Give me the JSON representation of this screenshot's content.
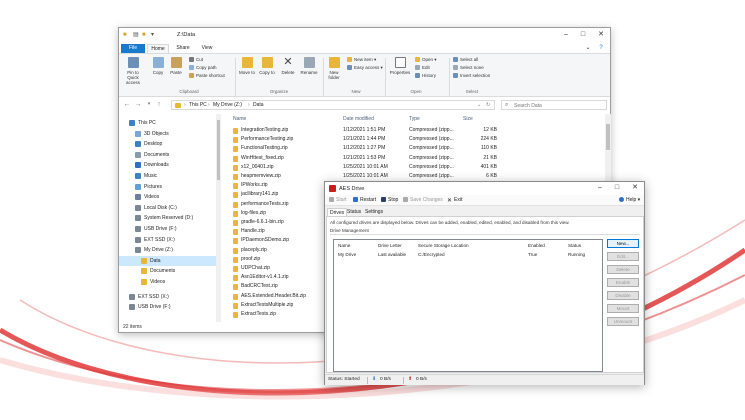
{
  "colors": {
    "accent_blue": "#1979ca",
    "folder_yellow": "#e8b63a",
    "selection": "#cce8ff",
    "brand_red": "#c81e1e",
    "swoosh_red": "#e03a3a"
  },
  "explorer": {
    "title": "Z:\\Data",
    "menu_tabs": [
      "File",
      "Home",
      "Share",
      "View"
    ],
    "ribbon": {
      "pin_label": "Pin to Quick access",
      "copy_label": "Copy",
      "paste_label": "Paste",
      "cut_label": "Cut",
      "copy_path_label": "Copy path",
      "paste_shortcut_label": "Paste shortcut",
      "move_to_label": "Move to",
      "copy_to_label": "Copy to",
      "delete_label": "Delete",
      "rename_label": "Rename",
      "new_folder_label": "New folder",
      "new_item_label": "New item",
      "easy_access_label": "Easy access",
      "properties_label": "Properties",
      "open_label": "Open",
      "edit_label": "Edit",
      "history_label": "History",
      "select_all_label": "Select all",
      "select_none_label": "Select none",
      "invert_selection_label": "Invert selection",
      "groups": [
        "Clipboard",
        "Organize",
        "New",
        "Open",
        "Select"
      ]
    },
    "breadcrumb": [
      "This PC",
      "My Drive (Z:)",
      "Data"
    ],
    "search_placeholder": "Search Data",
    "nav_items": [
      {
        "label": "This PC",
        "icon": "computer-icon"
      },
      {
        "label": "3D Objects",
        "icon": "cube-icon"
      },
      {
        "label": "Desktop",
        "icon": "desktop-icon"
      },
      {
        "label": "Documents",
        "icon": "documents-icon"
      },
      {
        "label": "Downloads",
        "icon": "download-icon"
      },
      {
        "label": "Music",
        "icon": "music-icon"
      },
      {
        "label": "Pictures",
        "icon": "pictures-icon"
      },
      {
        "label": "Videos",
        "icon": "videos-icon"
      },
      {
        "label": "Local Disk (C:)",
        "icon": "drive-icon"
      },
      {
        "label": "System Reserved (D:)",
        "icon": "drive-icon"
      },
      {
        "label": "USB Drive (F:)",
        "icon": "usb-drive-icon"
      },
      {
        "label": "EXT SSD (X:)",
        "icon": "drive-icon"
      },
      {
        "label": "My Drive (Z:)",
        "icon": "drive-icon"
      },
      {
        "label": "Data",
        "icon": "folder-icon"
      },
      {
        "label": "Documents",
        "icon": "folder-icon"
      },
      {
        "label": "Videos",
        "icon": "folder-icon"
      },
      {
        "label": "EXT SSD (X:)",
        "icon": "drive-icon"
      },
      {
        "label": "USB Drive (F:)",
        "icon": "usb-drive-icon"
      }
    ],
    "columns": [
      "Name",
      "Date modified",
      "Type",
      "Size"
    ],
    "files": [
      {
        "name": "IntegrationTesting.zip",
        "date": "1/12/2021 1:51 PM",
        "type": "Compressed (zipp...",
        "size": "12 KB"
      },
      {
        "name": "PerformanceTesting.zip",
        "date": "1/21/2021 1:44 PM",
        "type": "Compressed (zipp...",
        "size": "224 KB"
      },
      {
        "name": "FunctionalTesting.zip",
        "date": "1/12/2021 1:27 PM",
        "type": "Compressed (zipp...",
        "size": "110 KB"
      },
      {
        "name": "WinHttest_fixed.zip",
        "date": "1/21/2021 1:53 PM",
        "type": "Compressed (zipp...",
        "size": "21 KB"
      },
      {
        "name": "x12_00401.zip",
        "date": "1/25/2021 10:01 AM",
        "type": "Compressed (zipp...",
        "size": "401 KB"
      },
      {
        "name": "heapmemview.zip",
        "date": "1/25/2021 10:01 AM",
        "type": "Compressed (zipp...",
        "size": "6 KB"
      },
      {
        "name": "IPWorks.zip",
        "date": "",
        "type": "",
        "size": ""
      },
      {
        "name": "jacllibrary141.zip",
        "date": "",
        "type": "",
        "size": ""
      },
      {
        "name": "performanceTests.zip",
        "date": "",
        "type": "",
        "size": ""
      },
      {
        "name": "log-files.zip",
        "date": "",
        "type": "",
        "size": ""
      },
      {
        "name": "gradle-6.6.1-bin.zip",
        "date": "",
        "type": "",
        "size": ""
      },
      {
        "name": "Handle.zip",
        "date": "",
        "type": "",
        "size": ""
      },
      {
        "name": "IPDaemonSDemo.zip",
        "date": "",
        "type": "",
        "size": ""
      },
      {
        "name": "placeply.zip",
        "date": "",
        "type": "",
        "size": ""
      },
      {
        "name": "proof.zip",
        "date": "",
        "type": "",
        "size": ""
      },
      {
        "name": "UDPChat.zip",
        "date": "",
        "type": "",
        "size": ""
      },
      {
        "name": "Asn1Editor-v1.4.1.zip",
        "date": "",
        "type": "",
        "size": ""
      },
      {
        "name": "BadCRCTest.zip",
        "date": "",
        "type": "",
        "size": ""
      },
      {
        "name": "AES.Extended.Header.Bit.zip",
        "date": "",
        "type": "",
        "size": ""
      },
      {
        "name": "ExtractTestsMultiple.zip",
        "date": "",
        "type": "",
        "size": ""
      },
      {
        "name": "ExtractTests.zip",
        "date": "",
        "type": "",
        "size": ""
      }
    ],
    "status": "22 items"
  },
  "aes": {
    "title": "AES Drive",
    "toolbar": {
      "start": "Start",
      "restart": "Restart",
      "stop": "Stop",
      "save_changes": "Save Changes",
      "exit": "Exit",
      "help": "Help"
    },
    "tabs": [
      "Drives",
      "Status",
      "Settings"
    ],
    "description": "All configured drives are displayed below. Drives can be added, enabled, edited, enabled, and disabled from this view.",
    "section_label": "Drive Management",
    "list_columns": [
      "Name",
      "Drive Letter",
      "Secure Storage Location",
      "Enabled",
      "Status"
    ],
    "drives": [
      {
        "name": "My Drive",
        "letter": "Last available",
        "location": "C:/Encrypted",
        "enabled": "True",
        "status": "Running"
      }
    ],
    "buttons": [
      "New...",
      "Edit...",
      "Delete",
      "Enable",
      "Disable",
      "Mount",
      "Unmount"
    ],
    "status": {
      "service": "Status: Started",
      "read": "0 B/s",
      "write": "0 B/s"
    }
  }
}
